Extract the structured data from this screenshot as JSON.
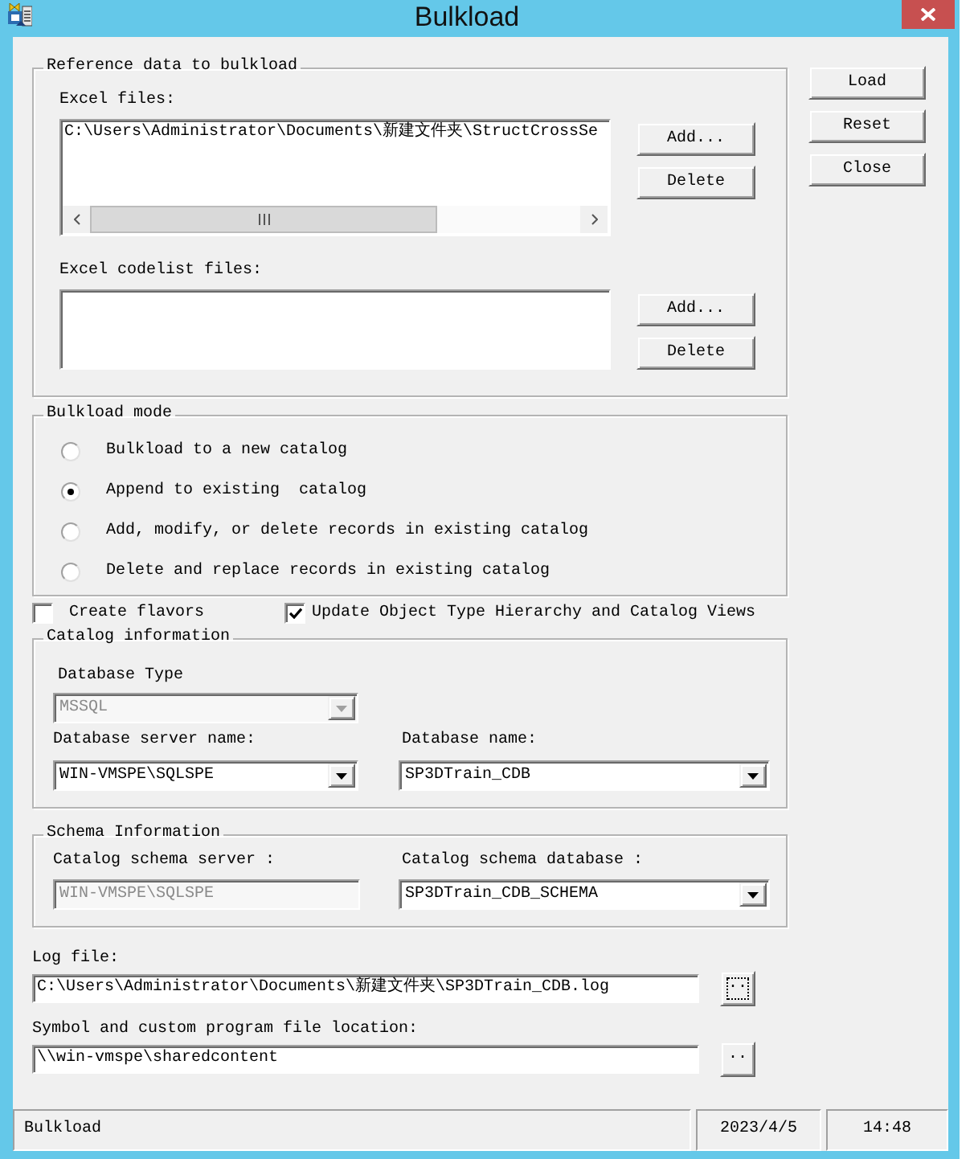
{
  "window": {
    "title": "Bulkload"
  },
  "reference_data": {
    "title": "Reference data to bulkload",
    "lists": [
      {
        "label": "Excel files:",
        "items": [
          "C:\\Users\\Administrator\\Documents\\新建文件夹\\StructCrossSe"
        ],
        "horizontal_scrollbar": true,
        "buttons": [
          "Add...",
          "Delete"
        ]
      },
      {
        "label": "Excel codelist files:",
        "horizontal_scrollbar": false,
        "buttons": [
          "Add...",
          "Delete"
        ]
      }
    ]
  },
  "actions": [
    "Load",
    "Reset",
    "Close"
  ],
  "bulkload_mode": {
    "title": "Bulkload mode",
    "options": [
      {
        "label": "Bulkload to a new catalog",
        "selected": false
      },
      {
        "label": "Append to existing  catalog",
        "selected": true
      },
      {
        "label": "Add, modify, or delete records in existing catalog",
        "selected": false
      },
      {
        "label": "Delete and replace records in existing catalog",
        "selected": false
      }
    ]
  },
  "checkboxes": [
    {
      "label": "Create flavors",
      "checked": false
    },
    {
      "label": "Update Object Type Hierarchy and Catalog Views",
      "checked": true
    }
  ],
  "catalog_information": {
    "title": "Catalog information",
    "rows": [
      [
        {
          "label": "Database Type",
          "kind": "combo",
          "value": "MSSQL",
          "disabled": true
        }
      ],
      [
        {
          "label": "Database server name:",
          "kind": "combo",
          "value": "WIN-VMSPE\\SQLSPE",
          "disabled": false
        },
        {
          "label": "Database name:",
          "kind": "combo",
          "value": "SP3DTrain_CDB",
          "disabled": false
        }
      ]
    ]
  },
  "schema_information": {
    "title": "Schema Information",
    "rows": [
      [
        {
          "label": "Catalog schema server :",
          "kind": "text",
          "value": "WIN-VMSPE\\SQLSPE",
          "disabled": true
        },
        {
          "label": "Catalog schema database :",
          "kind": "combo",
          "value": "SP3DTrain_CDB_SCHEMA",
          "disabled": false
        }
      ]
    ]
  },
  "paths": [
    {
      "label": "Log file:",
      "value": "C:\\Users\\Administrator\\Documents\\新建文件夹\\SP3DTrain_CDB.log",
      "browse": {
        "label": "..",
        "focused": true
      }
    },
    {
      "label": "Symbol and custom program file location:",
      "value": "\\\\win-vmspe\\sharedcontent",
      "browse": {
        "label": "..",
        "focused": false
      }
    }
  ],
  "status_bar": [
    "Bulkload",
    "2023/4/5",
    "14:48"
  ]
}
